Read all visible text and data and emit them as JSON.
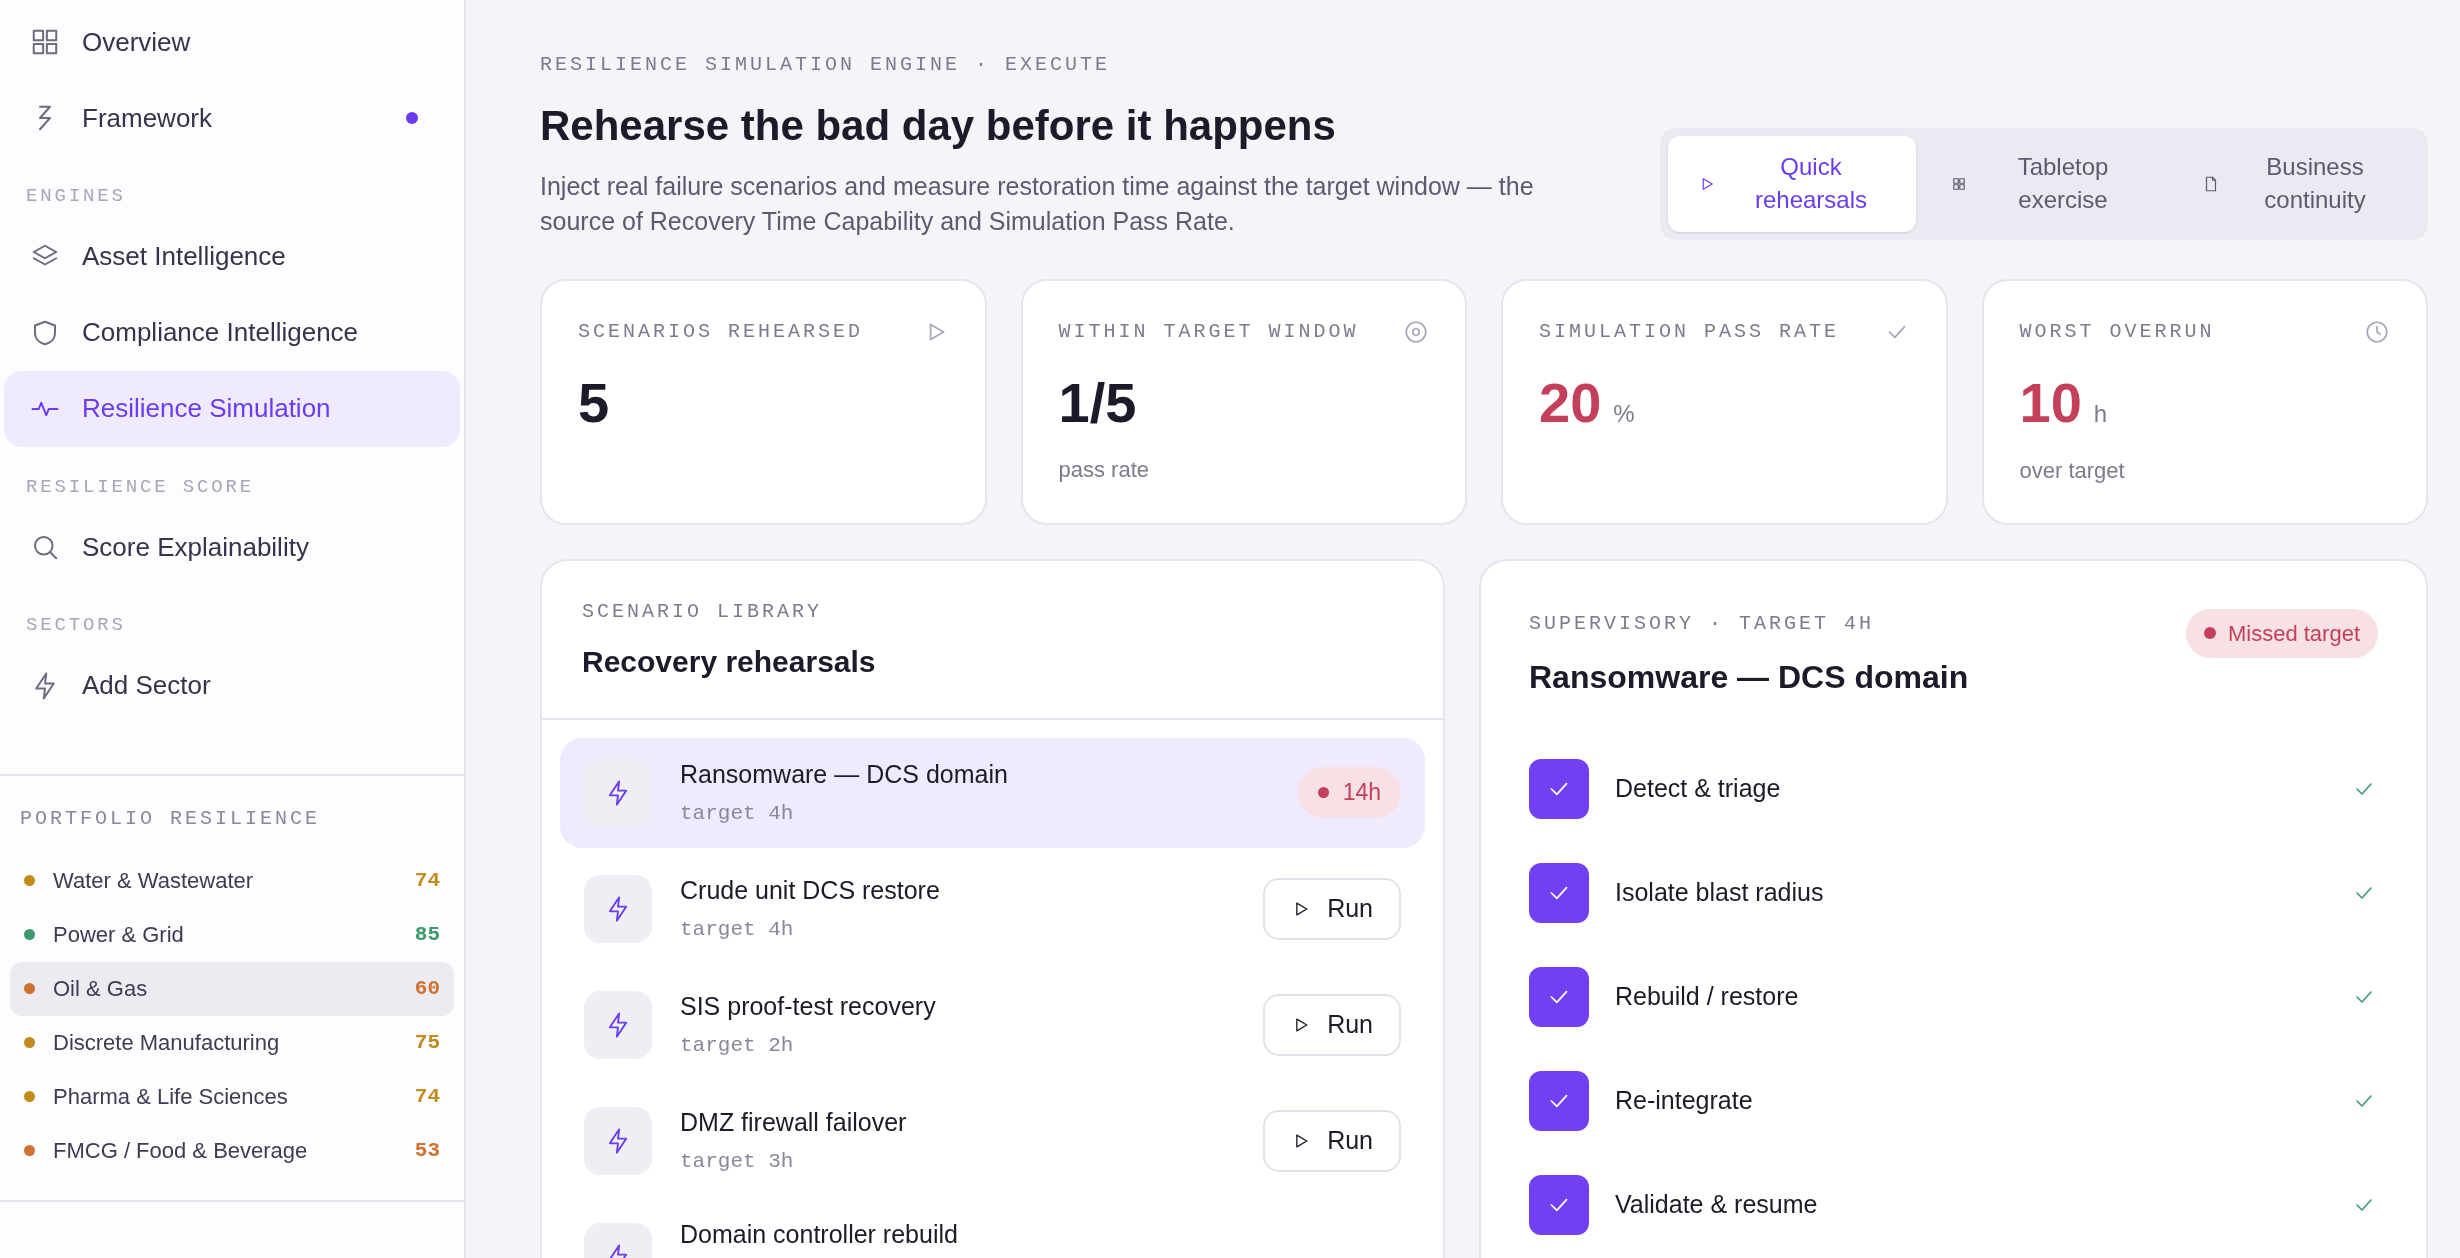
{
  "sidebar": {
    "items": [
      {
        "kind": "item",
        "label": "Overview",
        "selected": false,
        "indicator": false
      },
      {
        "kind": "item",
        "label": "Framework",
        "selected": false,
        "indicator": true
      },
      {
        "kind": "section",
        "label": "ENGINES"
      },
      {
        "kind": "item",
        "label": "Asset Intelligence",
        "selected": false,
        "indicator": false
      },
      {
        "kind": "item",
        "label": "Compliance Intelligence",
        "selected": false,
        "indicator": false
      },
      {
        "kind": "item",
        "label": "Resilience Simulation",
        "selected": true,
        "indicator": false
      },
      {
        "kind": "section",
        "label": "RESILIENCE SCORE"
      },
      {
        "kind": "item",
        "label": "Score Explainability",
        "selected": false,
        "indicator": false
      },
      {
        "kind": "section",
        "label": "SECTORS"
      },
      {
        "kind": "item",
        "label": "Add Sector",
        "selected": false,
        "indicator": false
      }
    ],
    "portfolio": {
      "title": "PORTFOLIO RESILIENCE",
      "sectors": [
        {
          "name": "Water & Wastewater",
          "score": "74",
          "color": "#c28b1c",
          "selected": false
        },
        {
          "name": "Power & Grid",
          "score": "85",
          "color": "#3f9a6b",
          "selected": false
        },
        {
          "name": "Oil & Gas",
          "score": "60",
          "color": "#cf7230",
          "selected": true
        },
        {
          "name": "Discrete Manufacturing",
          "score": "75",
          "color": "#c28b1c",
          "selected": false
        },
        {
          "name": "Pharma & Life Sciences",
          "score": "74",
          "color": "#c28b1c",
          "selected": false
        },
        {
          "name": "FMCG / Food & Beverage",
          "score": "53",
          "color": "#cf7230",
          "selected": false
        }
      ]
    }
  },
  "header": {
    "eyebrow": "RESILIENCE SIMULATION ENGINE · EXECUTE",
    "title": "Rehearse the bad day before it happens",
    "description": "Inject real failure scenarios and measure restoration time against the target window — the source of Recovery Time Capability and Simulation Pass Rate."
  },
  "tabs": [
    {
      "label": "Quick rehearsals",
      "selected": true
    },
    {
      "label": "Tabletop exercise",
      "selected": false
    },
    {
      "label": "Business continuity",
      "selected": false
    }
  ],
  "stats": [
    {
      "label": "SCENARIOS REHEARSED",
      "value": "5"
    },
    {
      "label": "WITHIN TARGET WINDOW",
      "value": "1/5",
      "caption": "pass rate"
    },
    {
      "label": "SIMULATION PASS RATE",
      "value": "20",
      "unit": "%",
      "color": "#c4405a"
    },
    {
      "label": "WORST OVERRUN",
      "value": "10",
      "unit": "h",
      "caption": "over target",
      "color": "#c4405a"
    }
  ],
  "library": {
    "eyebrow": "SCENARIO LIBRARY",
    "title": "Recovery rehearsals",
    "scenarios": [
      {
        "kind": "result",
        "title": "Ransomware — DCS domain",
        "target": "target 4h",
        "result": "14h",
        "selected": true
      },
      {
        "kind": "action",
        "title": "Crude unit DCS restore",
        "target": "target 4h",
        "action": "Run",
        "selected": false
      },
      {
        "kind": "action",
        "title": "SIS proof-test recovery",
        "target": "target 2h",
        "action": "Run",
        "selected": false
      },
      {
        "kind": "action",
        "title": "DMZ firewall failover",
        "target": "target 3h",
        "action": "Run",
        "selected": false
      },
      {
        "kind": "partial",
        "title": "Domain controller rebuild",
        "selected": false
      }
    ]
  },
  "detail": {
    "eyebrow": "SUPERVISORY · TARGET 4H",
    "title": "Ransomware — DCS domain",
    "status": "Missed target",
    "steps": [
      {
        "label": "Detect & triage",
        "checked": true
      },
      {
        "label": "Isolate blast radius",
        "checked": true
      },
      {
        "label": "Rebuild / restore",
        "checked": true
      },
      {
        "label": "Re-integrate",
        "checked": true
      },
      {
        "label": "Validate & resume",
        "checked": true
      }
    ]
  }
}
